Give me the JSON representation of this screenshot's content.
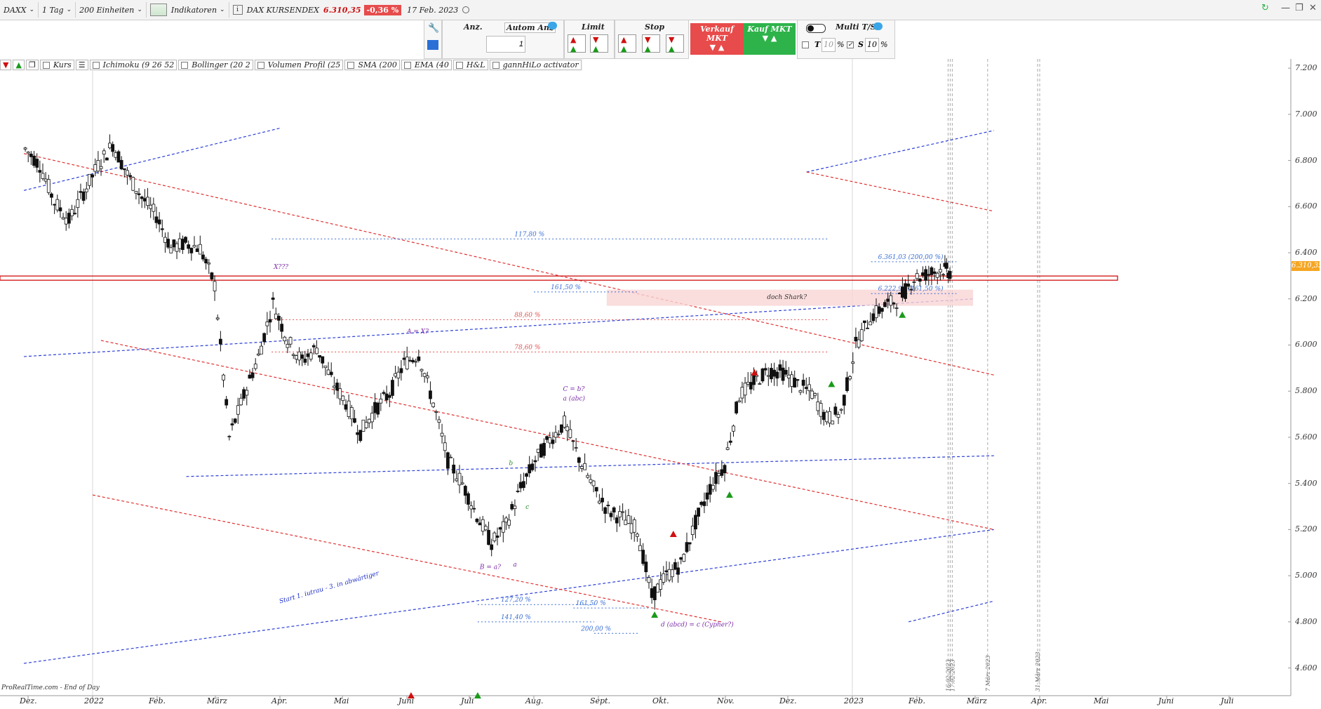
{
  "toolbar": {
    "symbol": "DAXX",
    "timeframe": "1 Tag",
    "units": "200 Einheiten",
    "indicators": "Indikatoren",
    "instrument_name": "DAX KURSENDEX",
    "price": "6.310,35",
    "change": "-0,36 %",
    "date": "17 Feb. 2023"
  },
  "order_panel": {
    "anz_label": "Anz.",
    "autom_label": "Autom Anz",
    "qty_value": "1",
    "limit_label": "Limit",
    "stop_label": "Stop",
    "sell_label": "Verkauf MKT",
    "buy_label": "Kauf MKT",
    "multi_label": "Multi T/S",
    "t_label": "T",
    "t_value": "10",
    "s_label": "S",
    "s_value": "10",
    "pct": "%"
  },
  "indicator_bar": {
    "kurs": "Kurs",
    "items": [
      "Ichimoku (9 26 52",
      "Bollinger (20 2",
      "Volumen Profil (25",
      "SMA (200",
      "EMA (40",
      "H&L",
      "gannHiLo activator"
    ]
  },
  "chart_data": {
    "type": "candlestick",
    "instrument": "DAXX",
    "interval": "1 Tag",
    "current_price": 6310.35,
    "current_price_label": "6.310,35",
    "y_axis": {
      "ylim": [
        4480,
        7240
      ],
      "ticks": [
        4600,
        4800,
        5000,
        5200,
        5400,
        5600,
        5800,
        6000,
        6200,
        6400,
        6600,
        6800,
        7000,
        7200
      ],
      "tick_labels": [
        "4.600",
        "4.800",
        "5.000",
        "5.200",
        "5.400",
        "5.600",
        "5.800",
        "6.000",
        "6.200",
        "6.400",
        "6.600",
        "6.800",
        "7.000",
        "7.200"
      ],
      "position": "right"
    },
    "x_axis": {
      "tick_labels": [
        "Dez.",
        "2022",
        "Feb.",
        "März",
        "Apr.",
        "Mai",
        "Juni",
        "Juli",
        "Aug.",
        "Sept.",
        "Okt.",
        "Nov.",
        "Dez.",
        "2023",
        "Feb.",
        "März",
        "Apr.",
        "Mai",
        "Juni",
        "Juli"
      ],
      "tick_dates": [
        "2021-12-01",
        "2022-01-01",
        "2022-02-01",
        "2022-03-01",
        "2022-04-01",
        "2022-05-01",
        "2022-06-01",
        "2022-07-01",
        "2022-08-01",
        "2022-09-01",
        "2022-10-01",
        "2022-11-01",
        "2022-12-01",
        "2023-01-01",
        "2023-02-01",
        "2023-03-01",
        "2023-04-01",
        "2023-05-01",
        "2023-06-01",
        "2023-07-01"
      ]
    },
    "price_path": [
      [
        "2021-11-29",
        6850
      ],
      [
        "2021-12-06",
        6780
      ],
      [
        "2021-12-13",
        6620
      ],
      [
        "2021-12-20",
        6540
      ],
      [
        "2021-12-27",
        6660
      ],
      [
        "2022-01-03",
        6780
      ],
      [
        "2022-01-10",
        6870
      ],
      [
        "2022-01-17",
        6740
      ],
      [
        "2022-01-24",
        6640
      ],
      [
        "2022-01-31",
        6560
      ],
      [
        "2022-02-07",
        6420
      ],
      [
        "2022-02-14",
        6440
      ],
      [
        "2022-02-21",
        6420
      ],
      [
        "2022-02-28",
        6260
      ],
      [
        "2022-03-07",
        5600
      ],
      [
        "2022-03-14",
        5780
      ],
      [
        "2022-03-21",
        5950
      ],
      [
        "2022-03-28",
        6180
      ],
      [
        "2022-04-04",
        6020
      ],
      [
        "2022-04-11",
        5930
      ],
      [
        "2022-04-18",
        5990
      ],
      [
        "2022-04-25",
        5850
      ],
      [
        "2022-05-02",
        5750
      ],
      [
        "2022-05-09",
        5620
      ],
      [
        "2022-05-16",
        5720
      ],
      [
        "2022-05-23",
        5790
      ],
      [
        "2022-05-30",
        5920
      ],
      [
        "2022-06-06",
        5960
      ],
      [
        "2022-06-13",
        5750
      ],
      [
        "2022-06-20",
        5500
      ],
      [
        "2022-06-27",
        5400
      ],
      [
        "2022-07-04",
        5260
      ],
      [
        "2022-07-11",
        5140
      ],
      [
        "2022-07-18",
        5220
      ],
      [
        "2022-07-25",
        5380
      ],
      [
        "2022-08-01",
        5500
      ],
      [
        "2022-08-08",
        5590
      ],
      [
        "2022-08-15",
        5660
      ],
      [
        "2022-08-22",
        5510
      ],
      [
        "2022-08-29",
        5380
      ],
      [
        "2022-09-05",
        5280
      ],
      [
        "2022-09-12",
        5250
      ],
      [
        "2022-09-19",
        5200
      ],
      [
        "2022-09-26",
        4910
      ],
      [
        "2022-10-03",
        5000
      ],
      [
        "2022-10-10",
        5050
      ],
      [
        "2022-10-17",
        5230
      ],
      [
        "2022-10-24",
        5380
      ],
      [
        "2022-10-31",
        5480
      ],
      [
        "2022-11-07",
        5780
      ],
      [
        "2022-11-14",
        5840
      ],
      [
        "2022-11-21",
        5890
      ],
      [
        "2022-11-28",
        5880
      ],
      [
        "2022-12-05",
        5830
      ],
      [
        "2022-12-12",
        5790
      ],
      [
        "2022-12-19",
        5680
      ],
      [
        "2022-12-26",
        5710
      ],
      [
        "2023-01-02",
        6000
      ],
      [
        "2023-01-09",
        6120
      ],
      [
        "2023-01-16",
        6170
      ],
      [
        "2023-01-23",
        6200
      ],
      [
        "2023-01-30",
        6290
      ],
      [
        "2023-02-06",
        6310
      ],
      [
        "2023-02-13",
        6330
      ],
      [
        "2023-02-17",
        6310
      ]
    ],
    "horizontal_levels": [
      {
        "label": "6.361,03 (200,00 %)",
        "value": 6361.03
      },
      {
        "label": "6.222,94 (161,50 %)",
        "value": 6222.94
      },
      {
        "label": "117,80 %",
        "value": 6460
      },
      {
        "label": "161,50 %",
        "value": 6230
      },
      {
        "label": "88,60 %",
        "value": 6110
      },
      {
        "label": "78,60 %",
        "value": 5970
      },
      {
        "label": "127,20 %",
        "value": 4875
      },
      {
        "label": "161,50 %",
        "value": 4860
      },
      {
        "label": "141,40 %",
        "value": 4800
      },
      {
        "label": "200,00 %",
        "value": 4750
      }
    ],
    "resistance_line": 6290,
    "annotations": [
      {
        "text": "X???",
        "date": "2022-03-29",
        "value": 6330
      },
      {
        "text": "A = X?",
        "date": "2022-06-01",
        "value": 6050
      },
      {
        "text": "C = b?",
        "date": "2022-08-15",
        "value": 5800
      },
      {
        "text": "a (abc)",
        "date": "2022-08-15",
        "value": 5760
      },
      {
        "text": "b",
        "date": "2022-07-20",
        "value": 5480
      },
      {
        "text": "c",
        "date": "2022-07-28",
        "value": 5290
      },
      {
        "text": "B = a?",
        "date": "2022-07-06",
        "value": 5030
      },
      {
        "text": "a",
        "date": "2022-07-22",
        "value": 5040
      },
      {
        "text": "d (abcd) = c (Cypher?)",
        "date": "2022-10-01",
        "value": 4780
      },
      {
        "text": "doch Shark?",
        "date": "2022-11-21",
        "value": 6200
      },
      {
        "text": "Start 1. iutrau - 3. in abwärtiger",
        "date": "2022-04-01",
        "value": 4880
      }
    ],
    "vertical_date_labels": [
      "16.02.2023",
      "17.02.2023",
      "7 März 2023",
      "31 März 2023"
    ],
    "source": "ProRealTime.com - End of Day"
  }
}
